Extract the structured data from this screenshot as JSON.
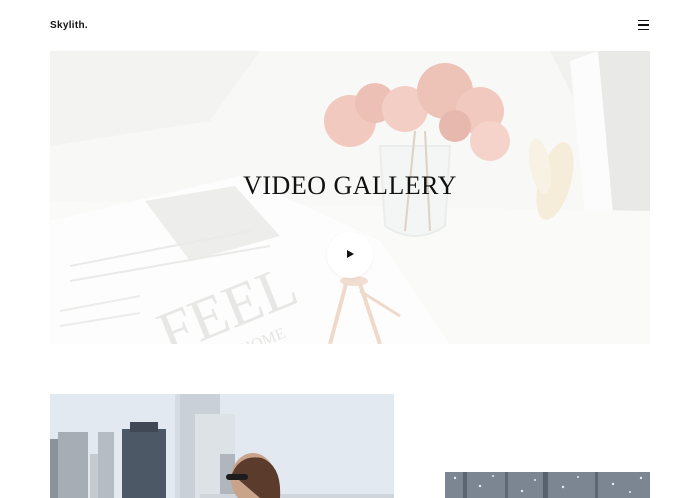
{
  "header": {
    "logo": "Skylith.",
    "menu_icon": "hamburger-menu-icon"
  },
  "hero": {
    "title": "VIDEO GALLERY",
    "play_icon": "play-icon",
    "magazine_text_large": "FEEL",
    "magazine_text_small": "AT HOME"
  },
  "gallery": {
    "items": [
      {
        "name": "city-portrait-photo"
      },
      {
        "name": "winter-forest-photo"
      }
    ]
  }
}
